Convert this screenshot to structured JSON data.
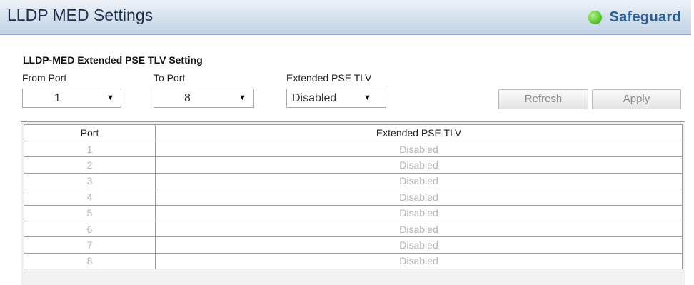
{
  "header": {
    "title": "LLDP MED Settings",
    "safeguard_label": "Safeguard",
    "safeguard_color": "#58c52c"
  },
  "form": {
    "section_title": "LLDP-MED Extended PSE TLV Setting",
    "from_port_label": "From Port",
    "from_port_value": "1",
    "to_port_label": "To Port",
    "to_port_value": "8",
    "pse_tlv_label": "Extended PSE TLV",
    "pse_tlv_value": "Disabled",
    "refresh_label": "Refresh",
    "apply_label": "Apply"
  },
  "table": {
    "columns": [
      "Port",
      "Extended PSE TLV"
    ],
    "rows": [
      [
        "1",
        "Disabled"
      ],
      [
        "2",
        "Disabled"
      ],
      [
        "3",
        "Disabled"
      ],
      [
        "4",
        "Disabled"
      ],
      [
        "5",
        "Disabled"
      ],
      [
        "6",
        "Disabled"
      ],
      [
        "7",
        "Disabled"
      ],
      [
        "8",
        "Disabled"
      ]
    ]
  }
}
